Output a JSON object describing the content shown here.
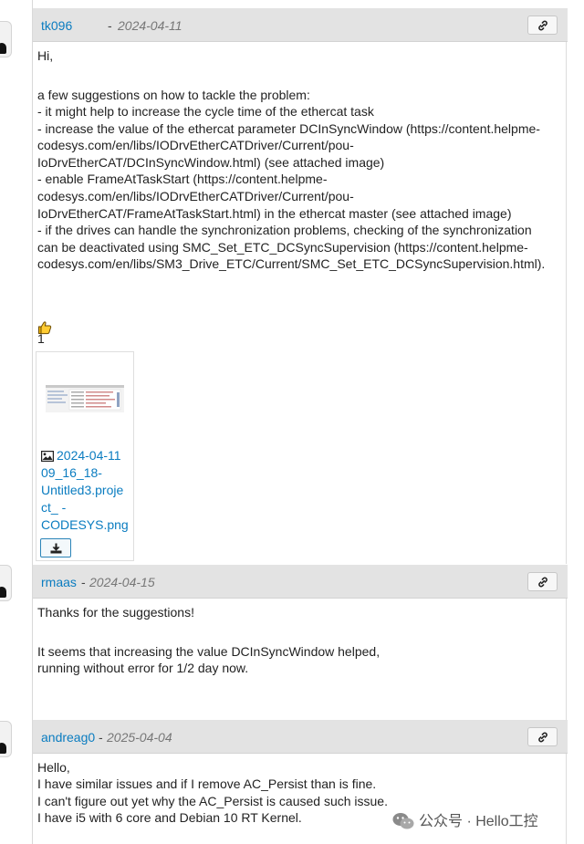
{
  "posts": [
    {
      "author": "tk096",
      "separator": "-",
      "date": "2024-04-11",
      "lines": [
        "Hi,",
        "a few suggestions on how to tackle the problem:",
        "- it might help to increase the cycle time of the ethercat task",
        "- increase the value of the ethercat parameter DCInSyncWindow (https://content.helpme-",
        "codesys.com/en/libs/IODrvEtherCATDriver/Current/pou-",
        "IoDrvEtherCAT/DCInSyncWindow.html) (see attached image)",
        "- enable FrameAtTaskStart (https://content.helpme-",
        "codesys.com/en/libs/IODrvEtherCATDriver/Current/pou-",
        "IoDrvEtherCAT/FrameAtTaskStart.html) in the ethercat master (see attached image)",
        "- if the drives can handle the synchronization problems, checking of the synchronization",
        "can be deactivated using SMC_Set_ETC_DCSyncSupervision (https://content.helpme-",
        "codesys.com/en/libs/SM3_Drive_ETC/Current/SMC_Set_ETC_DCSyncSupervision.html)."
      ],
      "likes": "1",
      "attachment": {
        "name_lines": [
          "2024-04-11",
          "09_16_18-",
          "Untitled3.proje",
          "ct_ -",
          "CODESYS.png"
        ]
      }
    },
    {
      "author": "rmaas",
      "separator": "-",
      "date": "2024-04-15",
      "lines": [
        "Thanks for the suggestions!",
        "It seems that increasing the value DCInSyncWindow helped,",
        "running without error for 1/2 day now."
      ]
    },
    {
      "author": "andreag0",
      "separator": "-",
      "date": "2025-04-04",
      "lines": [
        "Hello,",
        "I have similar issues and if I remove AC_Persist than is fine.",
        "I can't figure out yet why the AC_Persist is caused such issue.",
        "I have i5 with 6 core and Debian 10 RT Kernel."
      ]
    }
  ],
  "watermark": "公众号 · Hello工控",
  "icons": {
    "permalink": "link-icon",
    "like": "thumbs-up-icon",
    "image": "image-icon",
    "download": "download-icon"
  },
  "colors": {
    "link": "#0a7cc0",
    "header_bg": "#e3e3e3",
    "date": "#777777"
  }
}
